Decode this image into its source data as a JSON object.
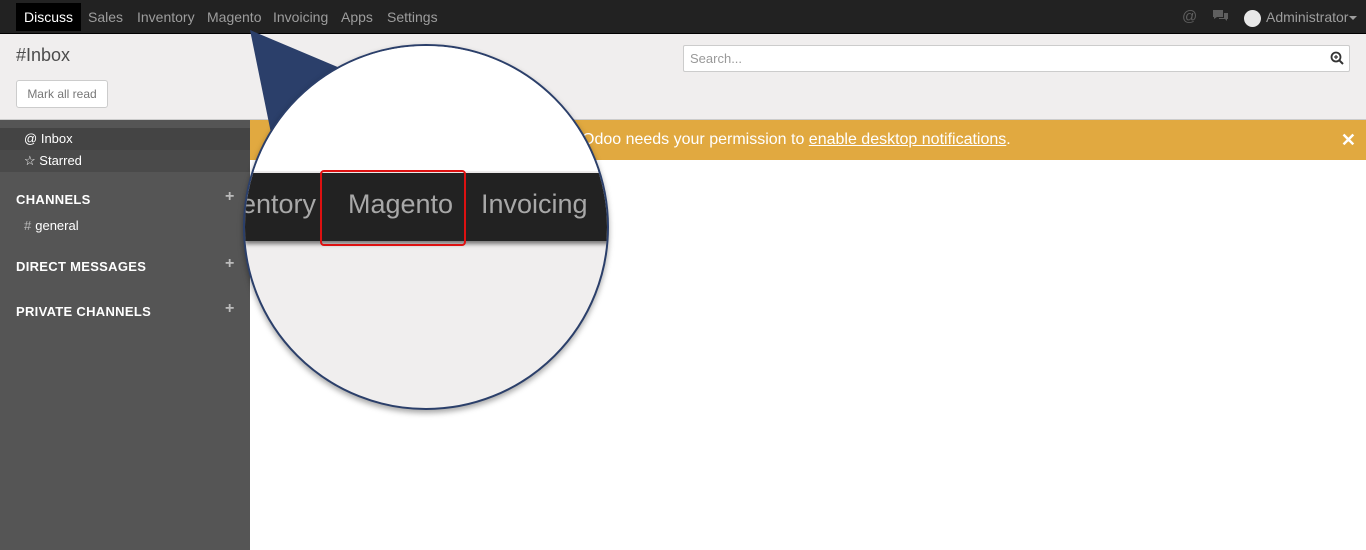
{
  "navbar": {
    "menu": [
      "Discuss",
      "Sales",
      "Inventory",
      "Magento",
      "Invoicing",
      "Apps",
      "Settings"
    ],
    "active": "Discuss",
    "icons": [
      "at-icon",
      "chat-icon"
    ],
    "user": "Administrator"
  },
  "control": {
    "title": "#Inbox",
    "mark_all_read": "Mark all read",
    "search_placeholder": "Search..."
  },
  "sidebar": {
    "mailboxes": [
      {
        "icon": "@",
        "label": "Inbox"
      },
      {
        "icon": "☆",
        "label": "Starred"
      }
    ],
    "sections": {
      "channels": "CHANNELS",
      "direct_messages": "DIRECT MESSAGES",
      "private_channels": "PRIVATE CHANNELS"
    },
    "channels": [
      {
        "hash": "#",
        "name": "general"
      }
    ]
  },
  "notification": {
    "prefix": "Odoo needs your permission to ",
    "link": "enable desktop notifications",
    "suffix": "."
  },
  "zoom": {
    "items": [
      "entory",
      "Magento",
      "Invoicing"
    ]
  },
  "colors": {
    "navbar": "#222222",
    "sidebar": "#555555",
    "notification": "#e1a940",
    "callout": "#2b3f6a",
    "highlight": "#dd1111"
  }
}
